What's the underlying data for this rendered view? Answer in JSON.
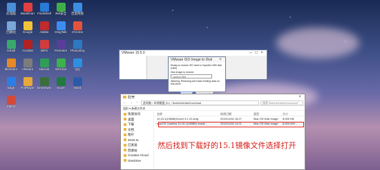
{
  "desktop": {
    "icons": [
      {
        "label": "此电脑",
        "color": "#4a8fd8"
      },
      {
        "label": "BandiCam",
        "color": "#e04040"
      },
      {
        "label": "FinalShell",
        "color": "#2a7ad8"
      },
      {
        "label": "360安全",
        "color": "#3fae4a"
      },
      {
        "label": "百度网盘",
        "color": "#3a8ee6"
      },
      {
        "label": "回收站",
        "color": "#7aa7d8"
      },
      {
        "label": "Google",
        "color": "#f2c23a"
      },
      {
        "label": "Adobe",
        "color": "#c02b2b"
      },
      {
        "label": "DingTalk",
        "color": "#3d8df0"
      },
      {
        "label": "Chrome",
        "color": "#e5533d"
      },
      {
        "label": "Xshell",
        "color": "#38a86b"
      },
      {
        "label": "Acrobat",
        "color": "#b22222"
      },
      {
        "label": "WPS",
        "color": "#d23c3c"
      },
      {
        "label": "Premiere",
        "color": "#5a3c9a"
      },
      {
        "label": "Photoshop",
        "color": "#2e79c2"
      },
      {
        "label": "Illustrator",
        "color": "#e58a26"
      },
      {
        "label": "VMware",
        "color": "#7c7c7c"
      },
      {
        "label": "Navicat",
        "color": "#2f9e57"
      },
      {
        "label": "WeChat",
        "color": "#3cb34a"
      },
      {
        "label": "QQ",
        "color": "#2f8ee0"
      },
      {
        "label": "Edge",
        "color": "#2c7ee6"
      },
      {
        "label": "PotPlayer",
        "color": "#e7a83a"
      },
      {
        "label": "Dreamweaver",
        "color": "#3a6f3a"
      },
      {
        "label": "Excel",
        "color": "#227a3f"
      },
      {
        "label": "Word",
        "color": "#2b5aa8"
      },
      {
        "label": "XMind",
        "color": "#d44a3a"
      }
    ]
  },
  "vmware_window": {
    "title": "VMware 15.5.0"
  },
  "boot_dialog": {
    "title": "VMware ISO Image to Disk",
    "line1": "Ready to restore ISO drive to Specific USB disk (click)",
    "field_label": "Disk image to restore:",
    "field_placeholder": "(select file)",
    "warning": "Warning: Restoring will erase existing data on this drive!",
    "ok_label": "OK",
    "cancel_label": "Cancel"
  },
  "file_dialog": {
    "title": "打开",
    "path": "此电脑 › 本地磁盘 (D:) › BaiduNetdiskDownload",
    "search_placeholder": "搜索\"BaiduNetdiskDownload\"",
    "toolbar_label": "组织 ▾    新建文件夹",
    "sidebar": [
      "快速访问",
      "桌面",
      "下载",
      "文档",
      "图片",
      "2019.11",
      "已发送",
      "回收站",
      "Creative Cloud",
      "OneDrive"
    ],
    "columns": [
      "名称",
      "修改日期",
      "类型",
      "大小"
    ],
    "rows": [
      {
        "name": "10.15.1(19B88)Clover 5.1 IO.dmg",
        "date": "2019/11/30 15:27",
        "type": "Mac OS Disk Image",
        "size": "8,000 KB"
      },
      {
        "name": "macOS Catalina 10.15.1(19B88) Install...",
        "date": "2019/11/30 14:21",
        "type": "Mac OS Disk Image",
        "size": "8,000,999 ..."
      }
    ]
  },
  "caption": "然后找到下载好的15.1镜像文件选择打开"
}
